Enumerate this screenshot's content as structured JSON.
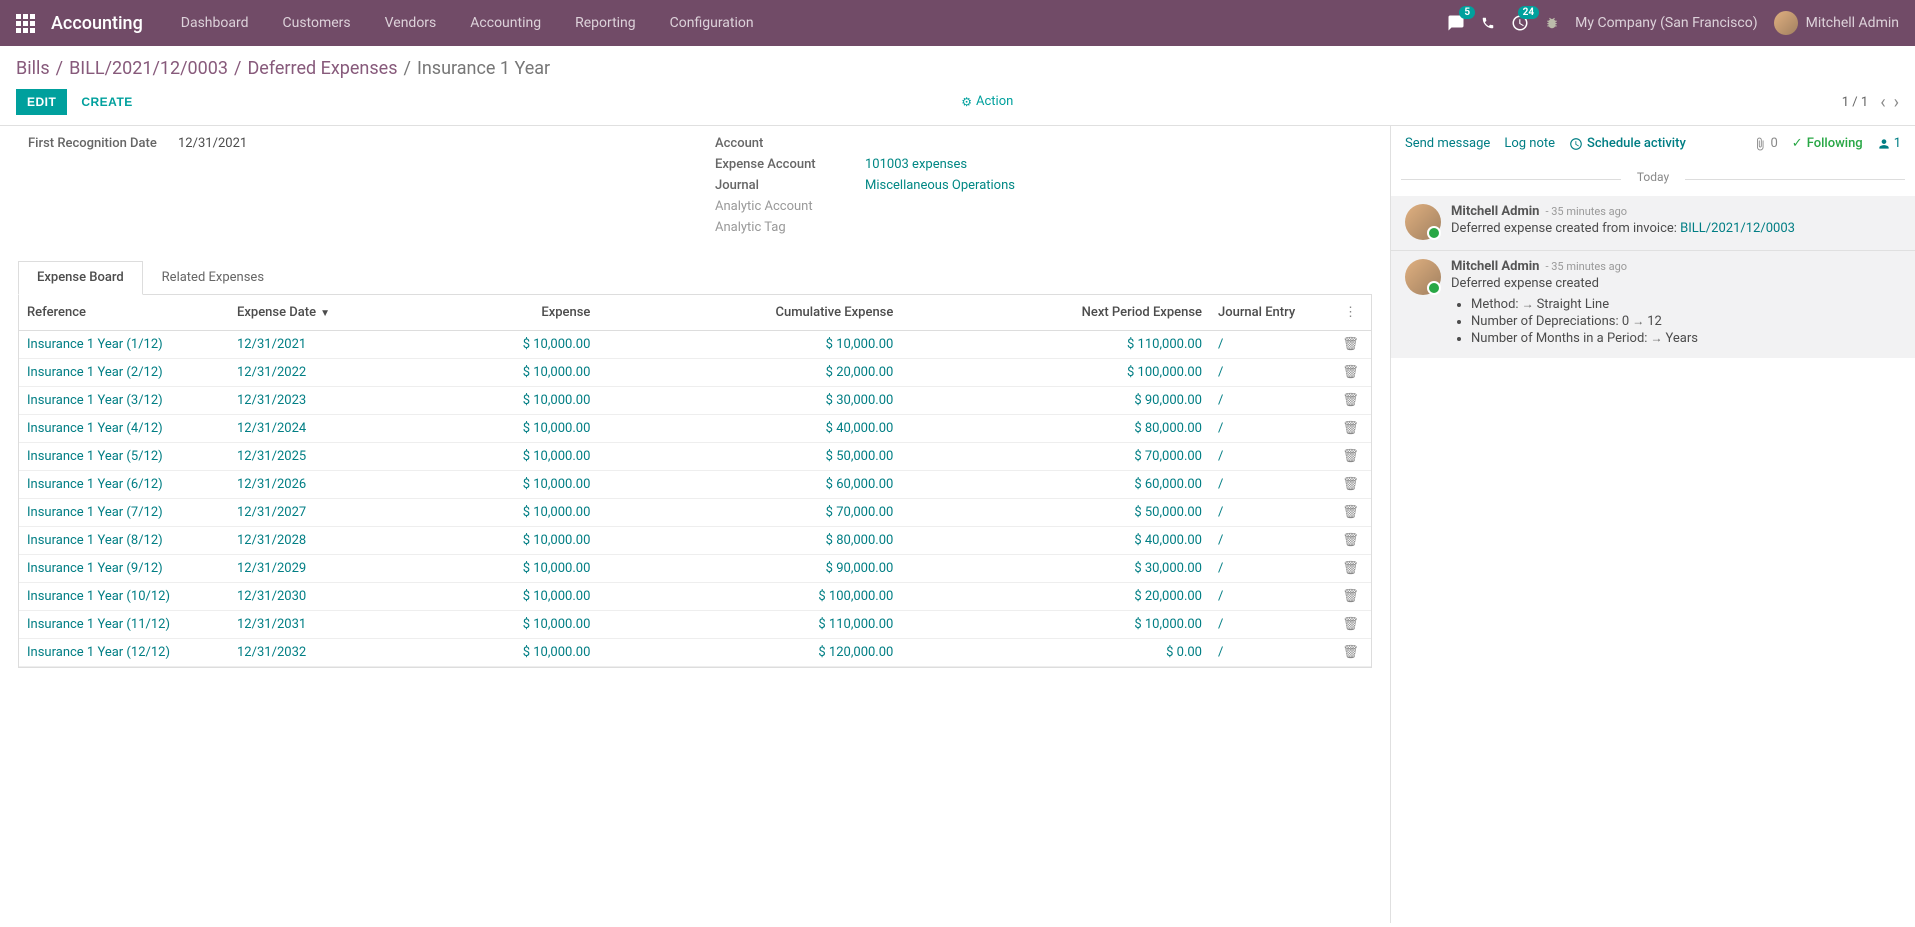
{
  "topnav": {
    "app_name": "Accounting",
    "menu": [
      "Dashboard",
      "Customers",
      "Vendors",
      "Accounting",
      "Reporting",
      "Configuration"
    ],
    "chat_badge": "5",
    "activity_badge": "24",
    "company": "My Company (San Francisco)",
    "user": "Mitchell Admin"
  },
  "breadcrumb": {
    "parts": [
      "Bills",
      "BILL/2021/12/0003",
      "Deferred Expenses"
    ],
    "current": "Insurance 1 Year"
  },
  "controls": {
    "edit": "EDIT",
    "create": "CREATE",
    "action": "Action",
    "pager": "1 / 1"
  },
  "form": {
    "first_recognition_label": "First Recognition Date",
    "first_recognition_value": "12/31/2021",
    "account_label": "Account",
    "expense_account_label": "Expense Account",
    "expense_account_value": "101003 expenses",
    "journal_label": "Journal",
    "journal_value": "Miscellaneous Operations",
    "analytic_account_label": "Analytic Account",
    "analytic_tag_label": "Analytic Tag"
  },
  "tabs": {
    "expense_board": "Expense Board",
    "related_expenses": "Related Expenses"
  },
  "table": {
    "headers": {
      "reference": "Reference",
      "expense_date": "Expense Date",
      "expense": "Expense",
      "cumulative": "Cumulative Expense",
      "next_period": "Next Period Expense",
      "journal_entry": "Journal Entry"
    },
    "rows": [
      {
        "ref": "Insurance 1 Year (1/12)",
        "date": "12/31/2021",
        "exp": "$ 10,000.00",
        "cum": "$ 10,000.00",
        "next": "$ 110,000.00",
        "entry": "/"
      },
      {
        "ref": "Insurance 1 Year (2/12)",
        "date": "12/31/2022",
        "exp": "$ 10,000.00",
        "cum": "$ 20,000.00",
        "next": "$ 100,000.00",
        "entry": "/"
      },
      {
        "ref": "Insurance 1 Year (3/12)",
        "date": "12/31/2023",
        "exp": "$ 10,000.00",
        "cum": "$ 30,000.00",
        "next": "$ 90,000.00",
        "entry": "/"
      },
      {
        "ref": "Insurance 1 Year (4/12)",
        "date": "12/31/2024",
        "exp": "$ 10,000.00",
        "cum": "$ 40,000.00",
        "next": "$ 80,000.00",
        "entry": "/"
      },
      {
        "ref": "Insurance 1 Year (5/12)",
        "date": "12/31/2025",
        "exp": "$ 10,000.00",
        "cum": "$ 50,000.00",
        "next": "$ 70,000.00",
        "entry": "/"
      },
      {
        "ref": "Insurance 1 Year (6/12)",
        "date": "12/31/2026",
        "exp": "$ 10,000.00",
        "cum": "$ 60,000.00",
        "next": "$ 60,000.00",
        "entry": "/"
      },
      {
        "ref": "Insurance 1 Year (7/12)",
        "date": "12/31/2027",
        "exp": "$ 10,000.00",
        "cum": "$ 70,000.00",
        "next": "$ 50,000.00",
        "entry": "/"
      },
      {
        "ref": "Insurance 1 Year (8/12)",
        "date": "12/31/2028",
        "exp": "$ 10,000.00",
        "cum": "$ 80,000.00",
        "next": "$ 40,000.00",
        "entry": "/"
      },
      {
        "ref": "Insurance 1 Year (9/12)",
        "date": "12/31/2029",
        "exp": "$ 10,000.00",
        "cum": "$ 90,000.00",
        "next": "$ 30,000.00",
        "entry": "/"
      },
      {
        "ref": "Insurance 1 Year (10/12)",
        "date": "12/31/2030",
        "exp": "$ 10,000.00",
        "cum": "$ 100,000.00",
        "next": "$ 20,000.00",
        "entry": "/"
      },
      {
        "ref": "Insurance 1 Year (11/12)",
        "date": "12/31/2031",
        "exp": "$ 10,000.00",
        "cum": "$ 110,000.00",
        "next": "$ 10,000.00",
        "entry": "/"
      },
      {
        "ref": "Insurance 1 Year (12/12)",
        "date": "12/31/2032",
        "exp": "$ 10,000.00",
        "cum": "$ 120,000.00",
        "next": "$ 0.00",
        "entry": "/"
      }
    ]
  },
  "chat": {
    "send_message": "Send message",
    "log_note": "Log note",
    "schedule_activity": "Schedule activity",
    "attach_count": "0",
    "following": "Following",
    "followers_count": "1",
    "today_label": "Today",
    "messages": [
      {
        "author": "Mitchell Admin",
        "time": "- 35 minutes ago",
        "text_prefix": "Deferred expense created from invoice: ",
        "link": "BILL/2021/12/0003"
      },
      {
        "author": "Mitchell Admin",
        "time": "- 35 minutes ago",
        "text": "Deferred expense created",
        "changes": [
          {
            "label": "Method:",
            "from": "",
            "to": "Straight Line"
          },
          {
            "label": "Number of Depreciations:",
            "from": "0",
            "to": "12"
          },
          {
            "label": "Number of Months in a Period:",
            "from": "",
            "to": "Years"
          }
        ]
      }
    ]
  }
}
